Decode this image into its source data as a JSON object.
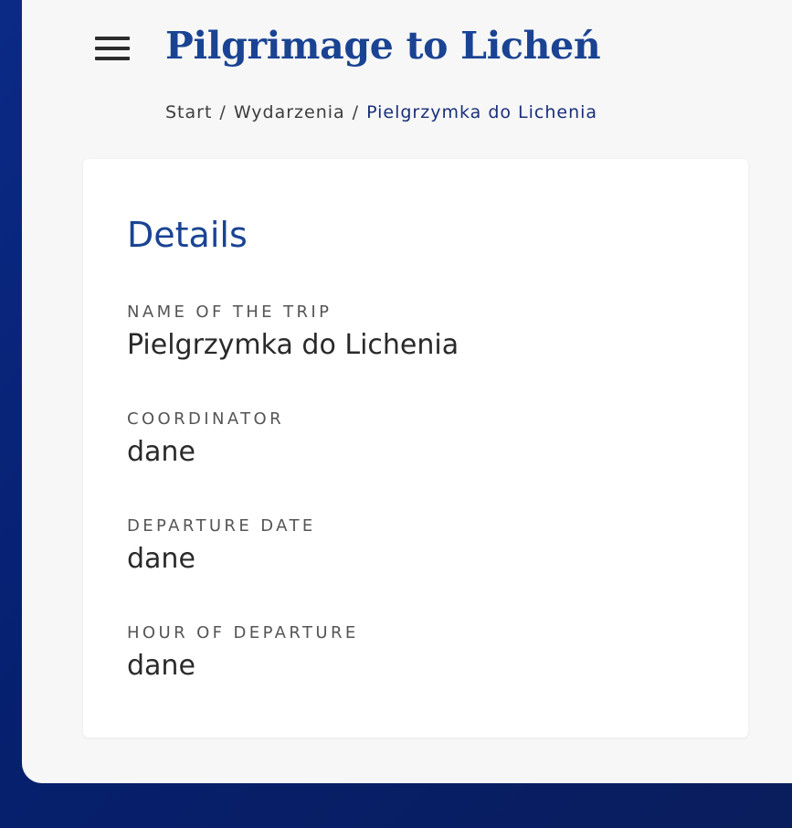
{
  "header": {
    "title": "Pilgrimage to Licheń",
    "menu_icon": "hamburger-menu-icon"
  },
  "breadcrumb": {
    "items": [
      "Start",
      "Wydarzenia"
    ],
    "separator": "/",
    "current": "Pielgrzymka do Lichenia"
  },
  "details": {
    "title": "Details",
    "fields": [
      {
        "label": "NAME OF THE TRIP",
        "value": "Pielgrzymka do Lichenia"
      },
      {
        "label": "COORDINATOR",
        "value": "dane"
      },
      {
        "label": "DEPARTURE DATE",
        "value": "dane"
      },
      {
        "label": "HOUR OF DEPARTURE",
        "value": "dane"
      }
    ]
  },
  "colors": {
    "accent": "#1a4393",
    "background": "#0b2a86",
    "panel": "#f7f7f7",
    "card": "#ffffff"
  }
}
